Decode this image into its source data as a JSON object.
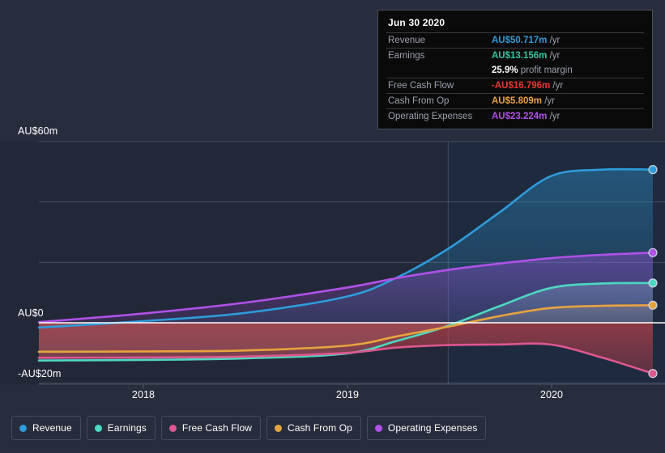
{
  "chart_data": {
    "type": "area",
    "title": "",
    "xlabel": "",
    "ylabel": "",
    "currency": "AU$",
    "ylim": [
      -20,
      60
    ],
    "y_ticks": [
      {
        "value": 60,
        "label": "AU$60m"
      },
      {
        "value": 40,
        "label": ""
      },
      {
        "value": 20,
        "label": ""
      },
      {
        "value": 0,
        "label": "AU$0"
      },
      {
        "value": -20,
        "label": "-AU$20m"
      }
    ],
    "x_ticks": [
      {
        "value": 2018,
        "label": "2018"
      },
      {
        "value": 2019,
        "label": "2019"
      },
      {
        "value": 2020,
        "label": "2020"
      }
    ],
    "x_range": [
      2017.5,
      2020.5
    ],
    "grid": true,
    "legend_position": "bottom",
    "forecast_divider_x": 2019.5,
    "series": [
      {
        "name": "Revenue",
        "color": "#2d9cdb",
        "x": [
          2017.5,
          2018.0,
          2018.5,
          2019.0,
          2019.25,
          2019.5,
          2019.75,
          2020.0,
          2020.25,
          2020.5
        ],
        "values": [
          -1.6,
          0.5,
          3.2,
          8.6,
          15.0,
          24.5,
          36.5,
          48.5,
          50.7,
          50.717
        ]
      },
      {
        "name": "Earnings",
        "color": "#4dd8c0",
        "x": [
          2017.5,
          2018.0,
          2018.5,
          2019.0,
          2019.25,
          2019.5,
          2019.75,
          2020.0,
          2020.25,
          2020.5
        ],
        "values": [
          -12.5,
          -12.3,
          -11.8,
          -10.2,
          -6.0,
          -1.0,
          5.5,
          11.5,
          13.0,
          13.156
        ]
      },
      {
        "name": "Free Cash Flow",
        "color": "#e0578f",
        "x": [
          2017.5,
          2018.0,
          2018.5,
          2019.0,
          2019.25,
          2019.5,
          2019.75,
          2020.0,
          2020.25,
          2020.5
        ],
        "values": [
          -11.6,
          -11.5,
          -11.2,
          -10.0,
          -8.2,
          -7.4,
          -7.2,
          -7.2,
          -11.5,
          -16.796
        ]
      },
      {
        "name": "Cash From Op",
        "color": "#e8a33d",
        "x": [
          2017.5,
          2018.0,
          2018.5,
          2019.0,
          2019.25,
          2019.5,
          2019.75,
          2020.0,
          2020.25,
          2020.5
        ],
        "values": [
          -9.6,
          -9.5,
          -9.2,
          -7.6,
          -4.5,
          -1.3,
          2.2,
          4.9,
          5.6,
          5.809
        ]
      },
      {
        "name": "Operating Expenses",
        "color": "#b051e8",
        "x": [
          2017.5,
          2018.0,
          2018.5,
          2019.0,
          2019.25,
          2019.5,
          2019.75,
          2020.0,
          2020.25,
          2020.5
        ],
        "values": [
          0.2,
          3.0,
          6.6,
          11.6,
          14.8,
          17.5,
          19.6,
          21.4,
          22.5,
          23.224
        ]
      }
    ]
  },
  "y_axis": {
    "top_label": "AU$60m",
    "zero_label": "AU$0",
    "bottom_label": "-AU$20m"
  },
  "x_axis": {
    "labels": [
      "2018",
      "2019",
      "2020"
    ]
  },
  "tooltip": {
    "title": "Jun 30 2020",
    "rows": [
      {
        "label": "Revenue",
        "amount": "AU$50.717m",
        "unit": "/yr",
        "amount_color": "#2d9cdb"
      },
      {
        "label": "Earnings",
        "amount": "AU$13.156m",
        "unit": "/yr",
        "amount_color": "#2fc89e"
      },
      {
        "label": "",
        "amount": "25.9%",
        "unit": "profit margin",
        "amount_color": "#ffffff",
        "is_margin": true
      },
      {
        "label": "Free Cash Flow",
        "amount": "-AU$16.796m",
        "unit": "/yr",
        "amount_color": "#e8392f"
      },
      {
        "label": "Cash From Op",
        "amount": "AU$5.809m",
        "unit": "/yr",
        "amount_color": "#e8a33d"
      },
      {
        "label": "Operating Expenses",
        "amount": "AU$23.224m",
        "unit": "/yr",
        "amount_color": "#b051e8"
      }
    ]
  },
  "legend": {
    "items": [
      {
        "label": "Revenue",
        "color": "#2d9cdb"
      },
      {
        "label": "Earnings",
        "color": "#4dd8c0"
      },
      {
        "label": "Free Cash Flow",
        "color": "#e0578f"
      },
      {
        "label": "Cash From Op",
        "color": "#e8a33d"
      },
      {
        "label": "Operating Expenses",
        "color": "#b051e8"
      }
    ]
  }
}
